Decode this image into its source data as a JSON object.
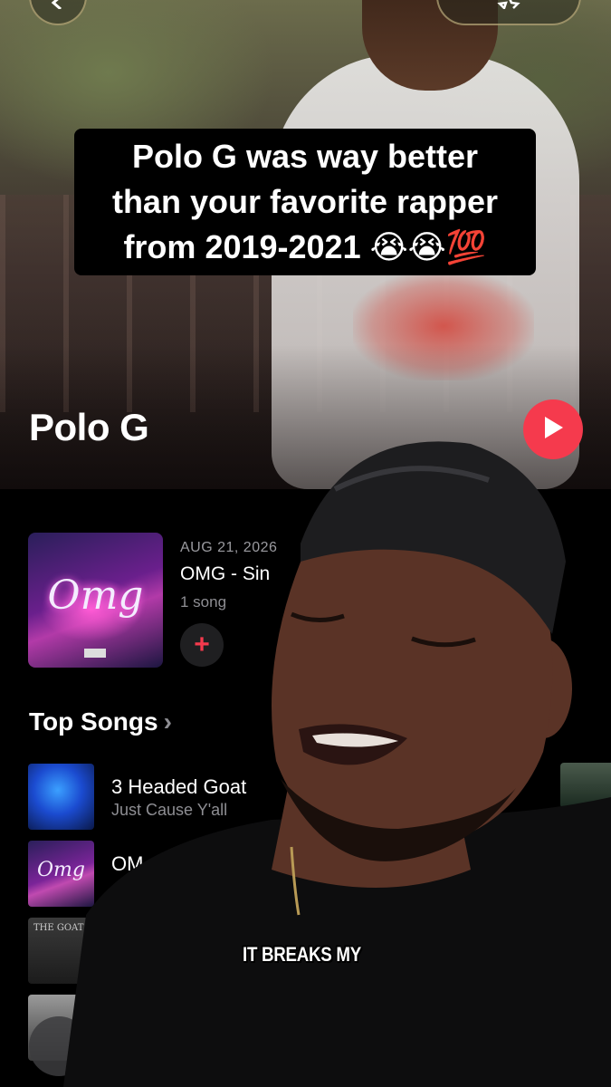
{
  "caption": {
    "line1": "Polo G was way better",
    "line2": "than your favorite rapper",
    "line3": "from 2019-2021 😭😭💯"
  },
  "artist": {
    "name": "Polo G"
  },
  "release": {
    "date": "AUG 21, 2026",
    "title": "OMG - Sin",
    "count": "1 song",
    "art_text": "Omg",
    "add_symbol": "+"
  },
  "top_songs": {
    "title": "Top Songs",
    "chevron": "›",
    "items": [
      {
        "title": "3 Headed Goat",
        "subtitle": "Just Cause Y'all"
      },
      {
        "title": "OM",
        "subtitle": ""
      },
      {
        "title": "",
        "subtitle": "",
        "art_text": "THE GOAT"
      },
      {
        "title": "",
        "subtitle": ""
      }
    ]
  },
  "reaction": {
    "subtitle": "IT BREAKS MY"
  },
  "colors": {
    "accent": "#f53a4d",
    "background": "#000000",
    "secondary_text": "#8e8e93"
  },
  "icons": {
    "back": "chevron-left-icon",
    "favorite": "star-icon",
    "play": "play-icon",
    "add": "plus-icon"
  }
}
